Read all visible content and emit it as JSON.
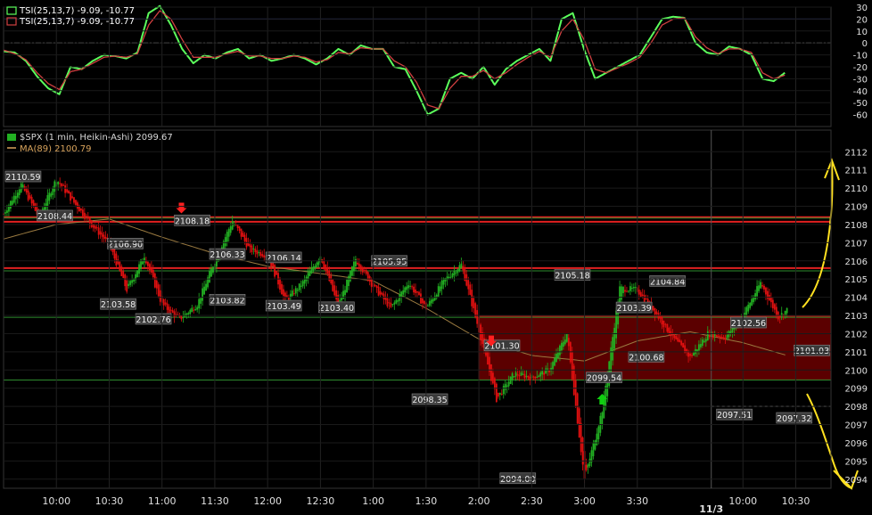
{
  "chart_data": [
    {
      "type": "line",
      "panel": "indicator",
      "legend": [
        {
          "text": "TSI(25,13,7) -9.09, -10.77",
          "color": "#ffffff"
        },
        {
          "text": "TSI(25,13,7) -9.09, -10.77",
          "color": "#ffffff"
        }
      ],
      "ylim": [
        -70,
        30
      ],
      "yticks": [
        30,
        20,
        10,
        0,
        -10,
        -20,
        -30,
        -40,
        -50,
        -60
      ],
      "reference_lines": [
        {
          "y": 20,
          "color": "#3a4ab8"
        },
        {
          "y": 0,
          "color": "#aaaaaa",
          "style": "dash-dot"
        },
        {
          "y": -20,
          "color": "#d01010"
        }
      ],
      "series": [
        {
          "color": "#5cff5c",
          "t": [
            0,
            10,
            20,
            30,
            40,
            50,
            60,
            70,
            80,
            90,
            100,
            110,
            120,
            130,
            140,
            150,
            160,
            170,
            180,
            190,
            200,
            210,
            220,
            230,
            240,
            250,
            260,
            270,
            280,
            290,
            300,
            310,
            320,
            330,
            340,
            350,
            360,
            370,
            380,
            390,
            400,
            410,
            420,
            430,
            440,
            450,
            460,
            470,
            480,
            490,
            500,
            510,
            520,
            530,
            540,
            550,
            560,
            570,
            580,
            590,
            600,
            610,
            620,
            630,
            640,
            650,
            660,
            670,
            680,
            690,
            700
          ],
          "values": [
            -7,
            -8,
            -15,
            -28,
            -38,
            -43,
            -20,
            -22,
            -15,
            -10,
            -11,
            -13,
            -8,
            25,
            31,
            15,
            -5,
            -17,
            -10,
            -13,
            -8,
            -5,
            -13,
            -10,
            -15,
            -13,
            -10,
            -13,
            -18,
            -13,
            -5,
            -10,
            -2,
            -5,
            -5,
            -20,
            -22,
            -40,
            -60,
            -55,
            -30,
            -25,
            -30,
            -20,
            -35,
            -22,
            -15,
            -10,
            -5,
            -15,
            20,
            25,
            -5,
            -30,
            -25,
            -20,
            -15,
            -10,
            5,
            20,
            22,
            21,
            0,
            -8,
            -10,
            -3,
            -5,
            -10,
            -30,
            -32,
            -25
          ]
        },
        {
          "color": "#d04040",
          "t": [
            0,
            10,
            20,
            30,
            40,
            50,
            60,
            70,
            80,
            90,
            100,
            110,
            120,
            130,
            140,
            150,
            160,
            170,
            180,
            190,
            200,
            210,
            220,
            230,
            240,
            250,
            260,
            270,
            280,
            290,
            300,
            310,
            320,
            330,
            340,
            350,
            360,
            370,
            380,
            390,
            400,
            410,
            420,
            430,
            440,
            450,
            460,
            470,
            480,
            490,
            500,
            510,
            520,
            530,
            540,
            550,
            560,
            570,
            580,
            590,
            600,
            610,
            620,
            630,
            640,
            650,
            660,
            670,
            680,
            690,
            700
          ],
          "values": [
            -6,
            -9,
            -14,
            -25,
            -34,
            -39,
            -24,
            -22,
            -17,
            -12,
            -11,
            -12,
            -9,
            15,
            27,
            20,
            3,
            -12,
            -12,
            -12,
            -9,
            -7,
            -11,
            -11,
            -13,
            -13,
            -11,
            -12,
            -16,
            -14,
            -8,
            -9,
            -4,
            -5,
            -5,
            -15,
            -20,
            -33,
            -52,
            -55,
            -38,
            -28,
            -28,
            -23,
            -30,
            -25,
            -18,
            -12,
            -7,
            -12,
            10,
            20,
            3,
            -22,
            -25,
            -21,
            -17,
            -12,
            0,
            15,
            20,
            21,
            5,
            -4,
            -9,
            -5,
            -5,
            -8,
            -25,
            -30,
            -27
          ]
        }
      ]
    },
    {
      "type": "line",
      "panel": "price",
      "legend": [
        {
          "text": "$SPX (1 min, Heikin-Ashi) 2099.67",
          "color": "#d8d8d8"
        },
        {
          "text": "MA(89) 2100.79",
          "color": "#d8a35c"
        }
      ],
      "ylim": [
        2093.5,
        2112.6
      ],
      "yticks": [
        2112,
        2111,
        2110,
        2109,
        2108,
        2107,
        2106,
        2105,
        2104,
        2103,
        2102,
        2101,
        2100,
        2099,
        2098,
        2097,
        2096,
        2095,
        2094
      ],
      "xticks": [
        {
          "label": "10:00",
          "t": 30
        },
        {
          "label": "10:30",
          "t": 60
        },
        {
          "label": "11:00",
          "t": 90
        },
        {
          "label": "11:30",
          "t": 120
        },
        {
          "label": "12:00",
          "t": 150
        },
        {
          "label": "12:30",
          "t": 180
        },
        {
          "label": "1:00",
          "t": 210
        },
        {
          "label": "1:30",
          "t": 240
        },
        {
          "label": "2:00",
          "t": 270
        },
        {
          "label": "2:30",
          "t": 300
        },
        {
          "label": "3:00",
          "t": 330
        },
        {
          "label": "3:30",
          "t": 360
        },
        {
          "label": "10:00",
          "t": 420
        },
        {
          "label": "10:30",
          "t": 450
        }
      ],
      "date_label": {
        "label": "11/3",
        "t": 402
      },
      "close": {
        "t": [
          0,
          10,
          20,
          30,
          40,
          50,
          60,
          70,
          80,
          90,
          100,
          110,
          120,
          130,
          140,
          150,
          160,
          170,
          180,
          190,
          200,
          210,
          220,
          230,
          240,
          250,
          260,
          270,
          280,
          290,
          300,
          310,
          320,
          330,
          340,
          350,
          360,
          370,
          380,
          390,
          400,
          410,
          420,
          430,
          440,
          445
        ],
        "values": [
          2108.6,
          2110.2,
          2108.4,
          2110.5,
          2109.2,
          2108.0,
          2106.9,
          2104.4,
          2106.3,
          2103.6,
          2102.8,
          2103.6,
          2106.0,
          2108.2,
          2106.6,
          2106.3,
          2103.8,
          2104.8,
          2106.3,
          2103.5,
          2106.1,
          2104.6,
          2103.4,
          2104.8,
          2103.4,
          2104.9,
          2105.8,
          2102.2,
          2098.4,
          2099.8,
          2099.6,
          2100.0,
          2102.0,
          2094.0,
          2097.8,
          2104.5,
          2104.4,
          2103.2,
          2101.8,
          2100.7,
          2102.0,
          2101.8,
          2103.0,
          2104.8,
          2102.9,
          2103.3
        ]
      },
      "ma": {
        "name": "MA(89)",
        "t": [
          0,
          30,
          60,
          90,
          120,
          150,
          180,
          210,
          240,
          270,
          300,
          330,
          360,
          390,
          420,
          445
        ],
        "values": [
          2107.2,
          2108.0,
          2108.3,
          2107.3,
          2106.4,
          2105.7,
          2105.3,
          2104.9,
          2103.4,
          2101.7,
          2100.8,
          2100.5,
          2101.6,
          2102.1,
          2101.5,
          2100.8
        ]
      },
      "price_labels": [
        "2110.59",
        "2108.44",
        "2108.18",
        "2106.90",
        "2106.33",
        "2106.14",
        "2105.95",
        "2103.58",
        "2102.76",
        "2103.82",
        "2103.49",
        "2103.40",
        "2098.35",
        "2101.30",
        "2094.00",
        "2105.18",
        "2103.39",
        "2099.54",
        "2100.68",
        "2104.84",
        "2102.56",
        "2097.51",
        "2101.03",
        "2097.32"
      ],
      "horizontal_lines": [
        {
          "y": 2108.4,
          "color": "#e02020"
        },
        {
          "y": 2108.15,
          "color": "#e02020"
        },
        {
          "y": 2105.6,
          "color": "#e02020"
        },
        {
          "y": 2105.45,
          "color": "#2e8b2e"
        },
        {
          "y": 2108.35,
          "color": "#2e8b2e"
        },
        {
          "y": 2102.9,
          "color": "#2e8b2e"
        },
        {
          "y": 2099.45,
          "color": "#2e8b2e"
        },
        {
          "y": 2098.0,
          "color": "#ffffff",
          "style": "dashed"
        }
      ],
      "zone": {
        "from": 2099.45,
        "to": 2102.95,
        "color": "#7a0000"
      },
      "signals": [
        {
          "kind": "sell-arrow",
          "color": "#ff2020"
        },
        {
          "kind": "sell-arrow",
          "color": "#ff2020"
        },
        {
          "kind": "buy-arrow",
          "color": "#10d010"
        }
      ],
      "annotations": [
        {
          "kind": "hand-drawn-arrow-up",
          "color": "#ffe020"
        },
        {
          "kind": "hand-drawn-arrow-down",
          "color": "#ffe020"
        }
      ]
    }
  ]
}
